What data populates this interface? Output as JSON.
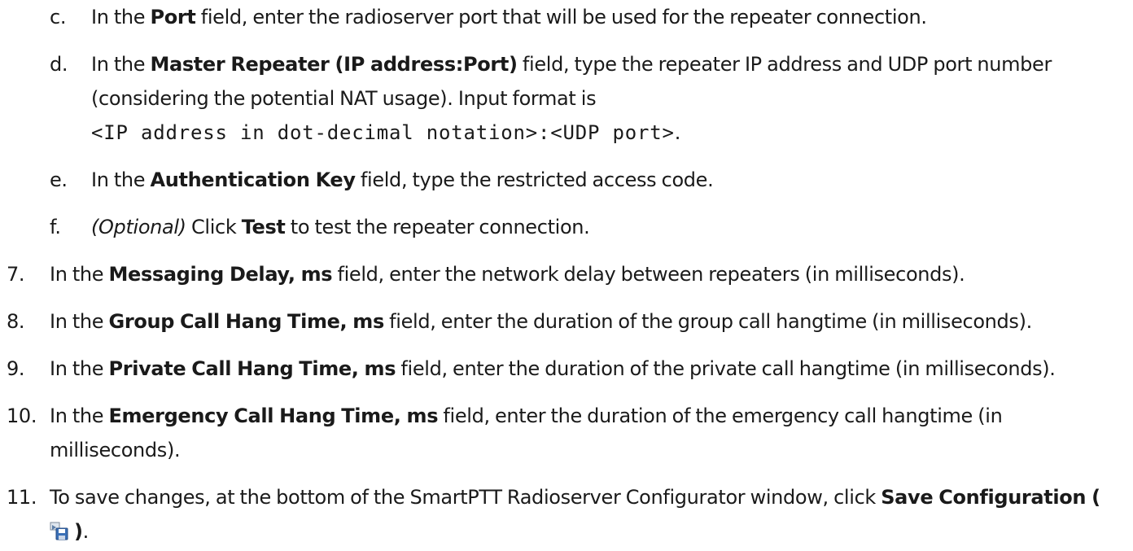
{
  "steps": {
    "c": {
      "marker": "c.",
      "t1": "In the ",
      "b1": "Port",
      "t2": " field, enter the radioserver port that will be used for the repeater connection."
    },
    "d": {
      "marker": "d.",
      "t1": "In the ",
      "b1": "Master Repeater (IP address:Port)",
      "t2": " field, type the repeater IP address and UDP port number (considering the potential NAT usage). Input format is",
      "code": "<IP address in dot-decimal notation>:<UDP port>",
      "t3": "."
    },
    "e": {
      "marker": "e.",
      "t1": "In the ",
      "b1": "Authentication Key",
      "t2": " field, type the restricted access code."
    },
    "f": {
      "marker": "f.",
      "i1": "(Optional)",
      "t1": " Click ",
      "b1": "Test",
      "t2": " to test the repeater connection."
    },
    "s7": {
      "marker": "7.",
      "t1": "In the ",
      "b1": "Messaging Delay, ms",
      "t2": " field, enter the network delay between repeaters (in milliseconds)."
    },
    "s8": {
      "marker": "8.",
      "t1": "In the ",
      "b1": "Group Call Hang Time, ms",
      "t2": " field, enter the duration of the group call hangtime (in milliseconds)."
    },
    "s9": {
      "marker": "9.",
      "t1": "In the ",
      "b1": "Private Call Hang Time, ms",
      "t2": " field, enter the duration of the private call hangtime (in milliseconds)."
    },
    "s10": {
      "marker": "10.",
      "t1": "In the ",
      "b1": "Emergency Call Hang Time, ms",
      "t2": " field, enter the duration of the emergency call hangtime (in milliseconds)."
    },
    "s11": {
      "marker": "11.",
      "t1": "To save changes, at the bottom of the SmartPTT Radioserver Configurator window, click ",
      "b1": "Save Configuration (",
      "icon": "save-configuration-icon",
      "b2": ")",
      "t2": "."
    }
  }
}
